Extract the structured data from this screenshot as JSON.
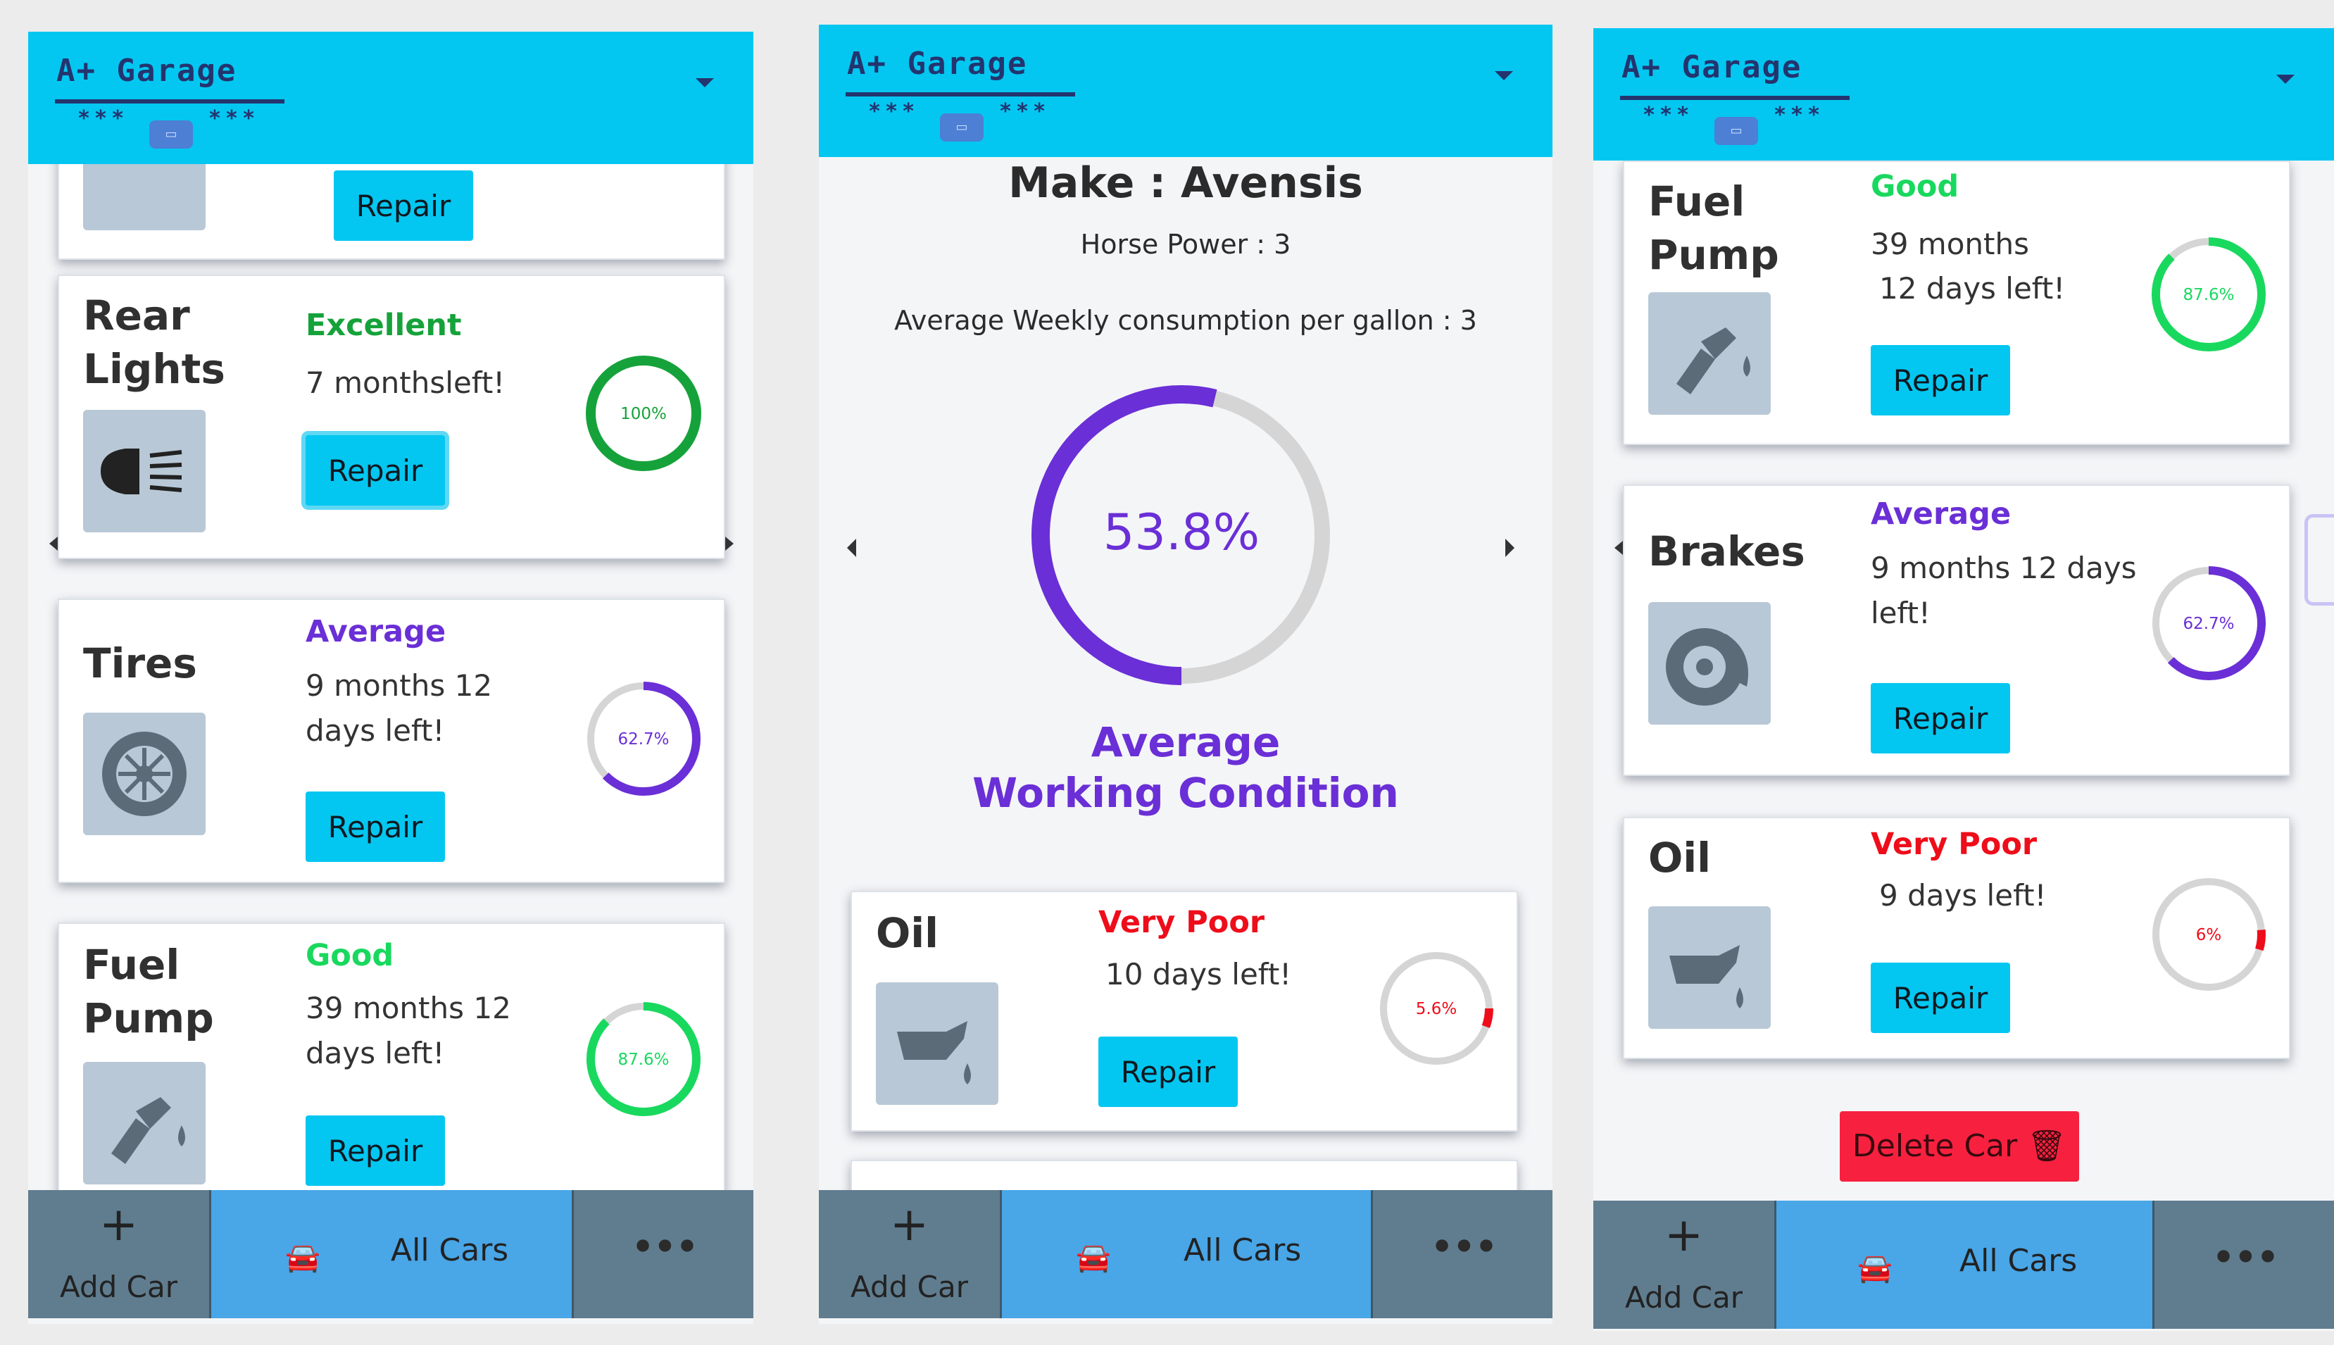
{
  "app": {
    "brand": "A+ Garage",
    "stars": "***"
  },
  "nav": {
    "add_car": "Add Car",
    "all_cars": "All Cars",
    "more": "•••",
    "plus": "+"
  },
  "repair_label": "Repair",
  "colors": {
    "header": "#03c7f1",
    "excellent": "#16a23a",
    "good": "#19d85e",
    "average": "#6a2fd6",
    "very_poor": "#ee0d1a"
  },
  "screen1": {
    "cards": [
      {
        "title": "",
        "status": "",
        "time_left": "",
        "icon": "partial-icon"
      },
      {
        "title": "Rear Lights",
        "status": "Excellent",
        "time_left": "7 monthsleft!",
        "percent": 100,
        "percent_label": "100%",
        "icon": "headlight-icon"
      },
      {
        "title": "Tires",
        "status": "Average",
        "time_left": "9 months 12 days left!",
        "percent": 62.7,
        "percent_label": "62.7%",
        "icon": "tire-icon"
      },
      {
        "title": "Fuel Pump",
        "status": "Good",
        "time_left": "39 months 12 days left!",
        "percent": 87.6,
        "percent_label": "87.6%",
        "icon": "fuel-pump-icon"
      }
    ]
  },
  "screen2": {
    "make": "Make : Avensis",
    "horse_power": "Horse Power : 3",
    "consumption": "Average Weekly consumption per gallon : 3",
    "overall_percent": 53.8,
    "overall_label": "53.8%",
    "condition_line1": "Average",
    "condition_line2": "Working Condition",
    "oil": {
      "title": "Oil",
      "status": "Very Poor",
      "time_left": "10 days left!",
      "percent": 5.6,
      "percent_label": "5.6%"
    }
  },
  "screen3": {
    "fuel": {
      "title": "Fuel Pump",
      "status": "Good",
      "time_left_1": "39 months",
      "time_left_2": "12 days left!",
      "percent": 87.6,
      "percent_label": "87.6%"
    },
    "brakes": {
      "title": "Brakes",
      "status": "Average",
      "time_left": "9 months 12 days left!",
      "percent": 62.7,
      "percent_label": "62.7%"
    },
    "oil": {
      "title": "Oil",
      "status": "Very Poor",
      "time_left": "9 days left!",
      "percent": 6,
      "percent_label": "6%"
    },
    "delete": "Delete Car"
  }
}
